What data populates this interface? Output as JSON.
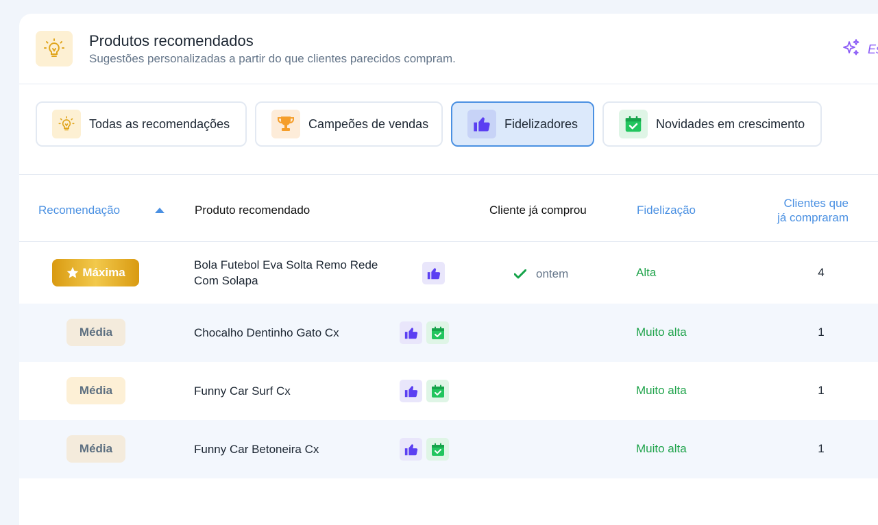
{
  "header": {
    "title": "Produtos recomendados",
    "subtitle": "Sugestões personalizadas a partir do que clientes parecidos compram.",
    "icon": "lightbulb-icon",
    "ai_label": "Es"
  },
  "tabs": [
    {
      "label": "Todas as recomendações",
      "icon": "lightbulb-icon",
      "active": false
    },
    {
      "label": "Campeões de vendas",
      "icon": "trophy-icon",
      "active": false
    },
    {
      "label": "Fidelizadores",
      "icon": "thumbs-up-icon",
      "active": true
    },
    {
      "label": "Novidades em crescimento",
      "icon": "calendar-check-icon",
      "active": false
    }
  ],
  "table": {
    "columns": {
      "recommendation": "Recomendação",
      "product": "Produto recomendado",
      "bought": "Cliente já comprou",
      "loyalty": "Fidelização",
      "customers_line1": "Clientes que",
      "customers_line2": "já compraram"
    },
    "rows": [
      {
        "level": "Máxima",
        "product_line1": "Bola Futebol Eva Solta Remo Rede",
        "product_line2": "Com Solapa",
        "bought": "ontem",
        "loyalty": "Alta",
        "customers": "4"
      },
      {
        "level": "Média",
        "product_line1": "Chocalho Dentinho Gato Cx",
        "loyalty": "Muito alta",
        "customers": "1"
      },
      {
        "level": "Média",
        "product_line1": "Funny Car Surf Cx",
        "loyalty": "Muito alta",
        "customers": "1"
      },
      {
        "level": "Média",
        "product_line1": "Funny Car Betoneira Cx",
        "loyalty": "Muito alta",
        "customers": "1"
      }
    ]
  },
  "colors": {
    "accent": "#4a90e2",
    "like": "#5b3ff2",
    "calendar": "#22c55e",
    "loyalty_text": "#1fa34b",
    "gold": "#e0a51c"
  }
}
